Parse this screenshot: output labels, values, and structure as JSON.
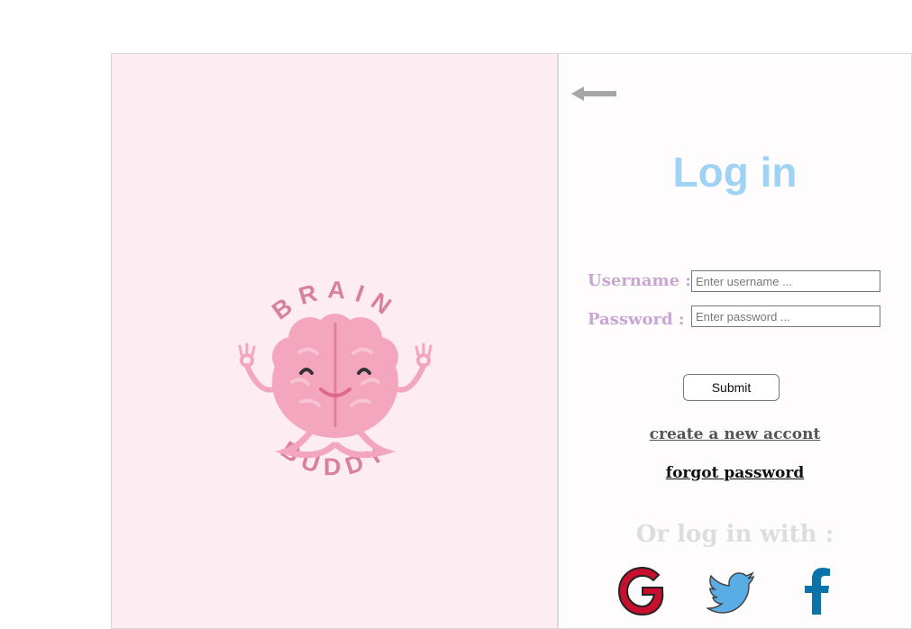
{
  "logo": {
    "top_text": "BRAIN",
    "bottom_text": "BUDDY"
  },
  "login": {
    "title": "Log in",
    "username_label": "Username :",
    "password_label": "Password :",
    "username_placeholder": "Enter username ...",
    "password_placeholder": "Enter password ...",
    "submit_label": "Submit",
    "create_account_link": "create a new accont",
    "forgot_password_link": "forgot password",
    "social_heading": "Or log in with :"
  },
  "icons": {
    "back": "arrow-left-icon",
    "google": "google-icon",
    "twitter": "twitter-icon",
    "facebook": "facebook-icon"
  },
  "colors": {
    "left_panel_bg": "#fdedf3",
    "title": "#9fd3f6",
    "labels": "#c9a6d2",
    "brain": "#f4a6bf",
    "logo_text": "#d9809c",
    "google": "#c8102e",
    "twitter": "#5aace4",
    "facebook": "#0a73a8"
  }
}
